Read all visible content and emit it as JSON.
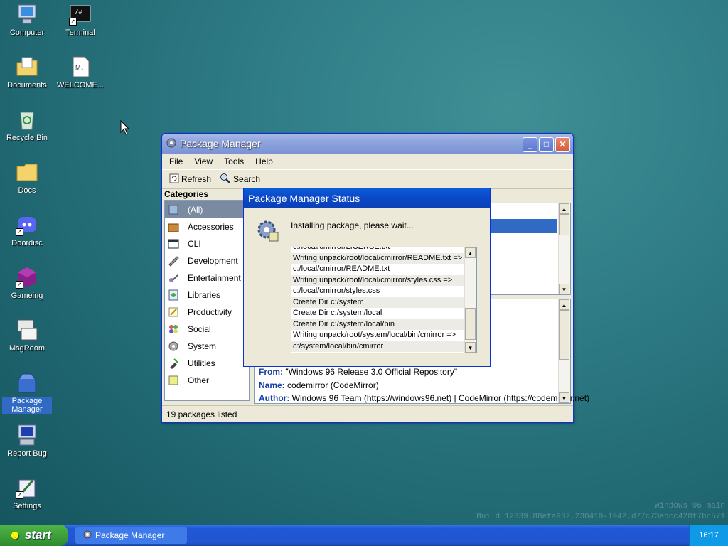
{
  "desktop": {
    "icons": [
      {
        "label": "Computer"
      },
      {
        "label": "Terminal"
      },
      {
        "label": "Documents"
      },
      {
        "label": "WELCOME..."
      },
      {
        "label": "Recycle Bin"
      },
      {
        "label": "Docs"
      },
      {
        "label": "Doordisc"
      },
      {
        "label": "Gameing"
      },
      {
        "label": "MsgRoom"
      },
      {
        "label": "Package Manager"
      },
      {
        "label": "Report Bug"
      },
      {
        "label": "Settings"
      }
    ],
    "terminal_glyph": "/#",
    "welcome_glyph": "M↓",
    "watermark_line1": "Windows 96 main",
    "watermark_line2": "Build 12839.88efa932.230410-1942.d77c73edcc428f7bc571"
  },
  "window": {
    "title": "Package Manager",
    "menu": [
      "File",
      "View",
      "Tools",
      "Help"
    ],
    "toolbar": {
      "refresh": "Refresh",
      "search": "Search"
    },
    "categories_heading": "Categories",
    "categories": [
      "(All)",
      "Accessories",
      "CLI",
      "Development",
      "Entertainment",
      "Libraries",
      "Productivity",
      "Social",
      "System",
      "Utilities",
      "Other"
    ],
    "details": {
      "from_label": "From:",
      "from_value": "\"Windows 96 Release 3.0 Official Repository\"",
      "name_label": "Name:",
      "name_value": "codemirror (CodeMirror)",
      "author_label": "Author:",
      "author_value": "Windows 96 Team (https://windows96.net) | CodeMirror (https://codemirror.net)"
    },
    "status": "19 packages listed"
  },
  "dialog": {
    "title": "Package Manager Status",
    "message": "Installing package, please wait...",
    "log": [
      "c:/local/cmirror/LICENSE.txt",
      "Writing unpack/root/local/cmirror/README.txt =>",
      "c:/local/cmirror/README.txt",
      "Writing unpack/root/local/cmirror/styles.css =>",
      "c:/local/cmirror/styles.css",
      "Create Dir c:/system",
      "Create Dir c:/system/local",
      "Create Dir c:/system/local/bin",
      "Writing unpack/root/system/local/bin/cmirror =>",
      "c:/system/local/bin/cmirror"
    ]
  },
  "taskbar": {
    "start": "start",
    "task": "Package Manager",
    "clock": "16:17"
  }
}
